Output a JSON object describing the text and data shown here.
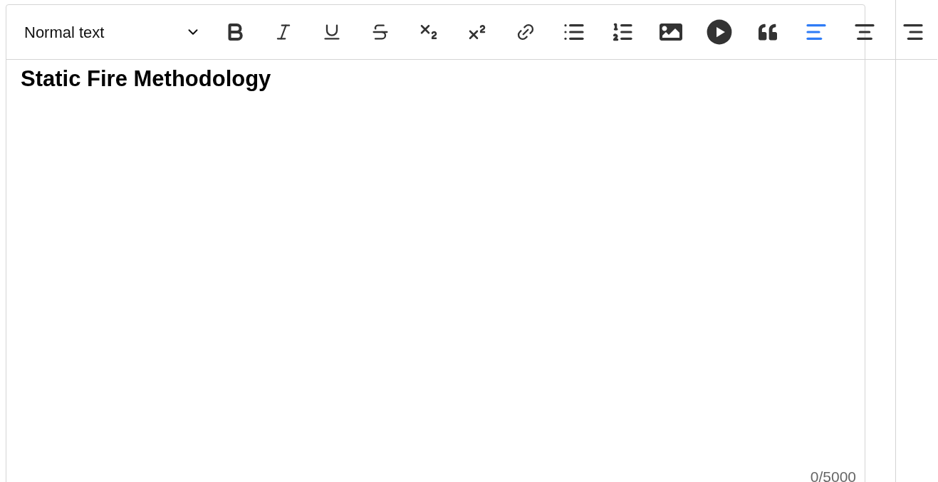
{
  "format_dropdown": {
    "value": "Normal text"
  },
  "toolbar": [
    {
      "kind": "bold",
      "selected": false
    },
    {
      "kind": "italic",
      "selected": false
    },
    {
      "kind": "underline",
      "selected": false
    },
    {
      "kind": "strikethrough",
      "selected": false
    },
    {
      "kind": "subscript",
      "selected": false
    },
    {
      "kind": "superscript",
      "selected": false
    },
    {
      "kind": "link",
      "selected": false
    },
    {
      "kind": "bullet_list",
      "selected": false
    },
    {
      "kind": "numbered_list",
      "selected": false
    },
    {
      "kind": "image",
      "selected": false
    },
    {
      "kind": "video",
      "selected": false
    },
    {
      "kind": "quote",
      "selected": false
    },
    {
      "kind": "align_left",
      "selected": true
    },
    {
      "kind": "align_center",
      "selected": false
    },
    {
      "kind": "align_right",
      "selected": false
    }
  ],
  "editor": {
    "content": "Static Fire Methodology",
    "counter": "0/5000"
  }
}
